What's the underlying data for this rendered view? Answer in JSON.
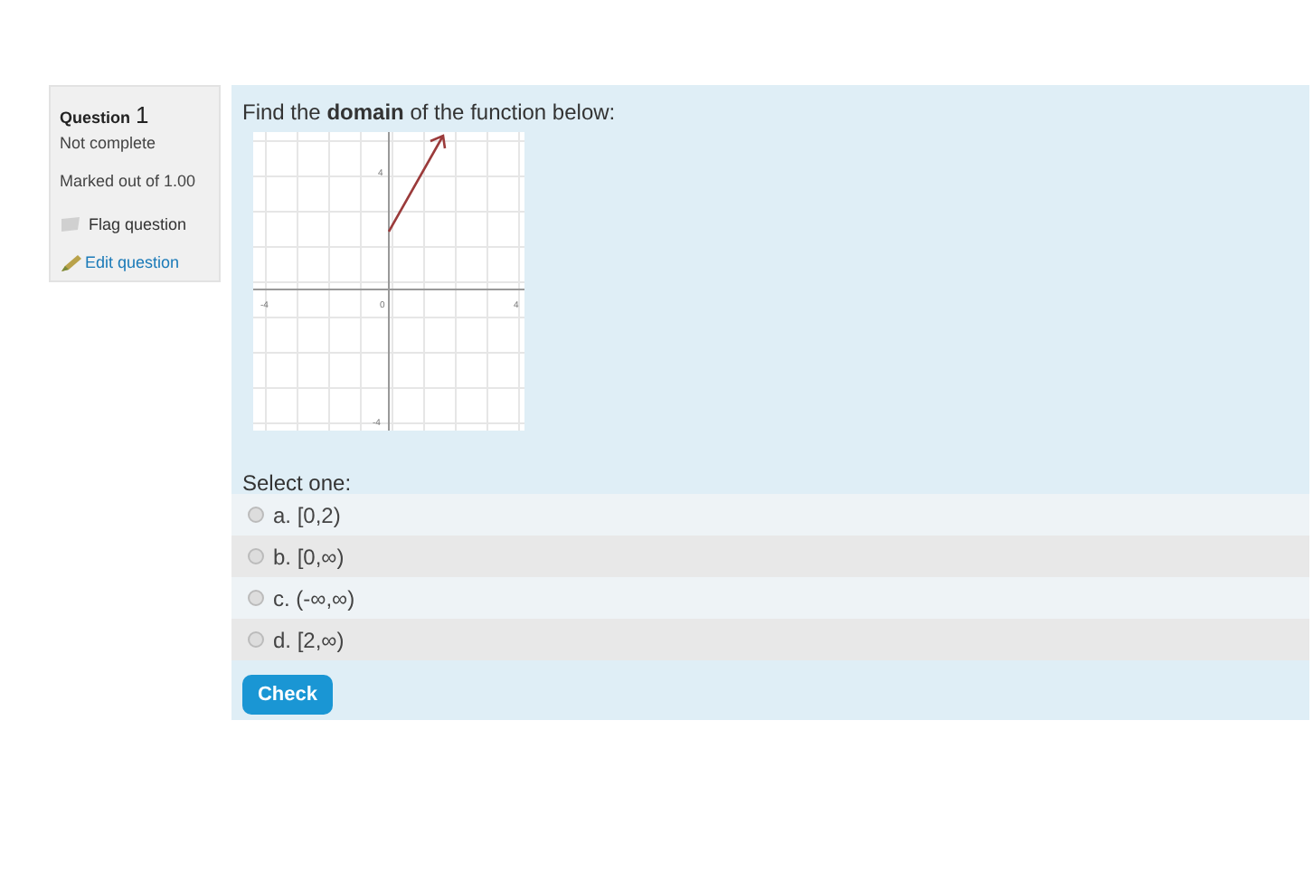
{
  "info": {
    "label": "Question",
    "number": "1",
    "state": "Not complete",
    "marks": "Marked out of 1.00",
    "flag": "Flag question",
    "edit": "Edit question"
  },
  "question": {
    "text": "Find the **domain** of the function below:",
    "graph": {
      "x_min": "-4",
      "x_max": "4",
      "origin": "0",
      "y_max": "4",
      "y_min": "-4"
    },
    "prompt": "Select one:",
    "options": [
      {
        "label": "a. [0,2)",
        "selected": false
      },
      {
        "label": "b. [0,∞)",
        "selected": false
      },
      {
        "label": "c. (-∞,∞)",
        "selected": false
      },
      {
        "label": "d. [2,∞)",
        "selected": false
      }
    ],
    "button": "Check"
  }
}
